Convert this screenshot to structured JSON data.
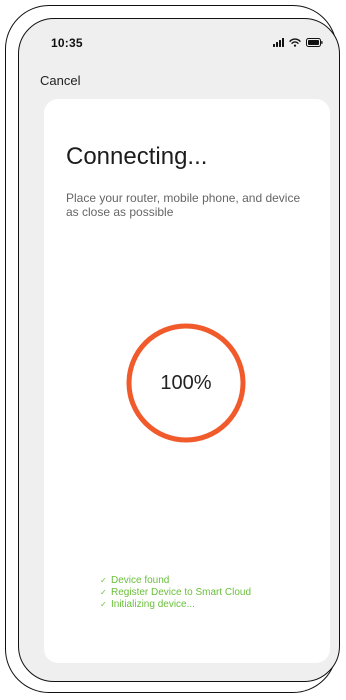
{
  "status_bar": {
    "time": "10:35",
    "icons": [
      "signal-icon",
      "wifi-icon",
      "battery-icon"
    ]
  },
  "nav": {
    "cancel_label": "Cancel"
  },
  "main": {
    "title": "Connecting...",
    "instructions": "Place your router, mobile phone, and device as close as possible",
    "progress": {
      "percent": 100,
      "label": "100%",
      "ring_color": "#f15a2b"
    },
    "steps": [
      {
        "label": "Device found",
        "icon": "check-icon",
        "status": "done"
      },
      {
        "label": "Register Device to Smart Cloud",
        "icon": "check-icon",
        "status": "done"
      },
      {
        "label": "Initializing device...",
        "icon": "check-icon",
        "status": "done"
      }
    ],
    "step_color": "#6abf3b"
  }
}
